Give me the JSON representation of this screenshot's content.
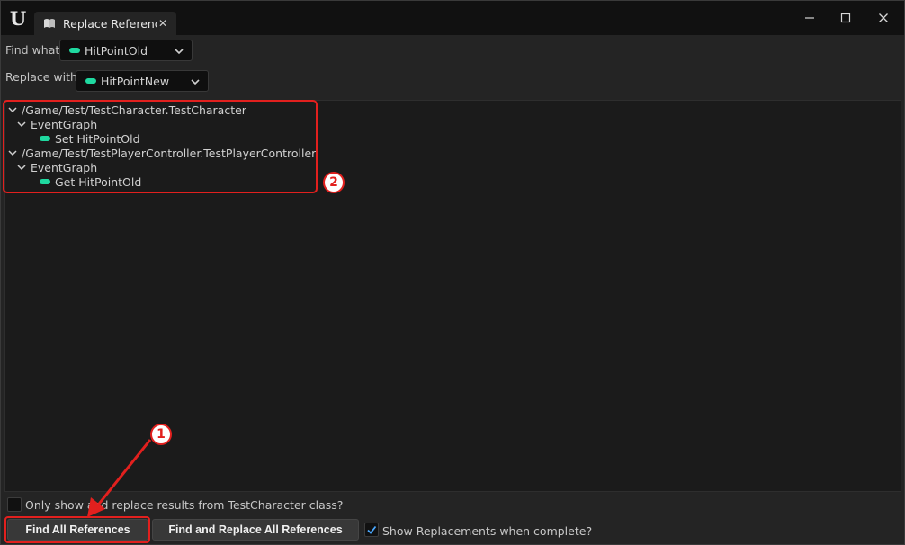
{
  "window": {
    "tab_title": "Replace Referenc",
    "colors": {
      "accent_pin": "#1fd9a0",
      "annotation": "#e2201e"
    }
  },
  "find_what": {
    "label": "Find what:",
    "value": "HitPointOld"
  },
  "replace_with": {
    "label": "Replace with:",
    "value": "HitPointNew"
  },
  "results": [
    {
      "path": "/Game/Test/TestCharacter.TestCharacter",
      "graph": "EventGraph",
      "node": "Set HitPointOld"
    },
    {
      "path": "/Game/Test/TestPlayerController.TestPlayerController",
      "graph": "EventGraph",
      "node": "Get HitPointOld"
    }
  ],
  "annotations": {
    "badge_1": "1",
    "badge_2": "2"
  },
  "options": {
    "only_show_label": "Only show and replace results from TestCharacter class?",
    "only_show_checked": false,
    "show_replacements_label": "Show Replacements when complete?",
    "show_replacements_checked": true
  },
  "buttons": {
    "find_all": "Find All References",
    "find_replace_all": "Find and Replace All References"
  }
}
